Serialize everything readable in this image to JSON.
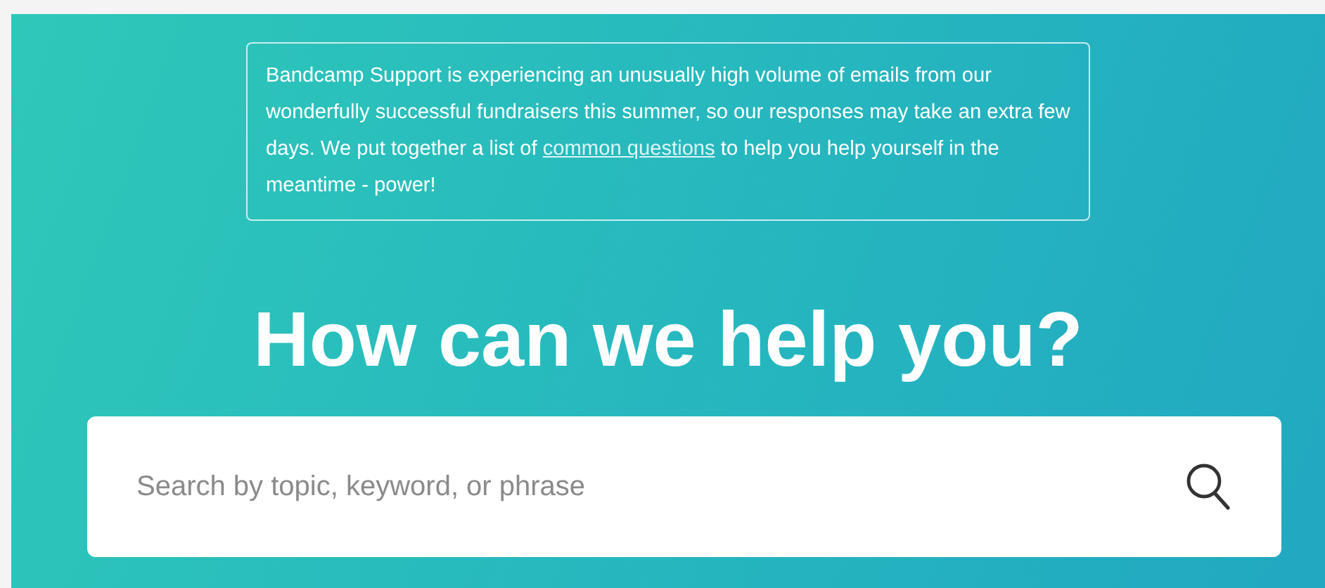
{
  "notice": {
    "text_before": "Bandcamp Support is experiencing an unusually high volume of emails from our wonderfully successful fundraisers this summer, so our responses may take an extra few days. We put together a list of ",
    "link": "common questions",
    "text_after": " to help you help yourself in the meantime - power!"
  },
  "heading": "How can we help you?",
  "search": {
    "placeholder": "Search by topic, keyword, or phrase"
  }
}
